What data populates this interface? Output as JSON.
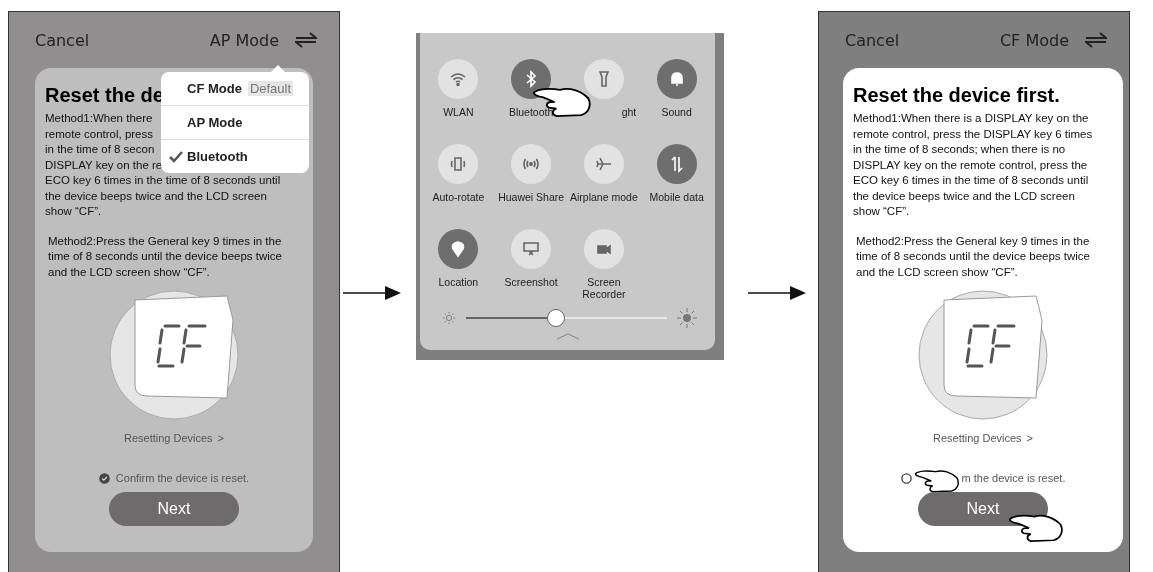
{
  "screens": [
    {
      "kind": "app",
      "cancel": "Cancel",
      "mode": "AP Mode",
      "title": "Reset the de",
      "method1": [
        "Method1:When there",
        "remote control, press",
        "in the time of 8 secon",
        "DISPLAY key on the re",
        "ECO key 6 times in the time of 8 seconds until",
        "the device beeps twice and the LCD screen",
        "show “CF”."
      ],
      "method2": [
        "Method2:Press the General key 9 times in the",
        "time of 8 seconds until the device beeps twice",
        "and the LCD screen show “CF”."
      ],
      "link": "Resetting Devices",
      "chevron": ">",
      "confirm": {
        "label": "Confirm the device is reset.",
        "checked": true
      },
      "button": "Next",
      "menu": [
        {
          "label": "CF Mode",
          "badge": "Default",
          "selected": false
        },
        {
          "label": "AP Mode",
          "selected": false
        },
        {
          "label": "Bluetooth",
          "selected": true
        }
      ]
    },
    {
      "kind": "panel",
      "tiles": [
        {
          "label": "WLAN",
          "on": false
        },
        {
          "label": "Bluetooth",
          "on": true
        },
        {
          "label": "ght",
          "on": false
        },
        {
          "label": "Sound",
          "on": true
        },
        {
          "label": "Auto-rotate",
          "on": false
        },
        {
          "label": "Huawei Share",
          "on": false
        },
        {
          "label": "Airplane mode",
          "on": false
        },
        {
          "label": "Mobile data",
          "on": true
        },
        {
          "label": "Location",
          "on": true
        },
        {
          "label": "Screenshot",
          "on": false
        },
        {
          "label": "Screen Recorder",
          "on": false
        }
      ],
      "brightness": {
        "level": 0.45
      }
    },
    {
      "kind": "app",
      "cancel": "Cancel",
      "mode": "CF Mode",
      "title": "Reset the device first.",
      "method1": [
        "Method1:When there is a DISPLAY key on the",
        "remote control, press the DISPLAY key 6 times",
        "in the time of 8 seconds; when there is no",
        "DISPLAY key on the remote control, press the",
        "ECO key 6 times in the time of 8 seconds until",
        "the device beeps twice and the LCD screen",
        "show “CF”."
      ],
      "method2": [
        "Method2:Press the General key 9 times in the",
        "time of 8 seconds until the device beeps twice",
        "and the LCD screen show “CF”."
      ],
      "link": "Resetting Devices",
      "chevron": ">",
      "confirm": {
        "label": "m the device is reset.",
        "checked": false
      },
      "button": "Next"
    }
  ]
}
